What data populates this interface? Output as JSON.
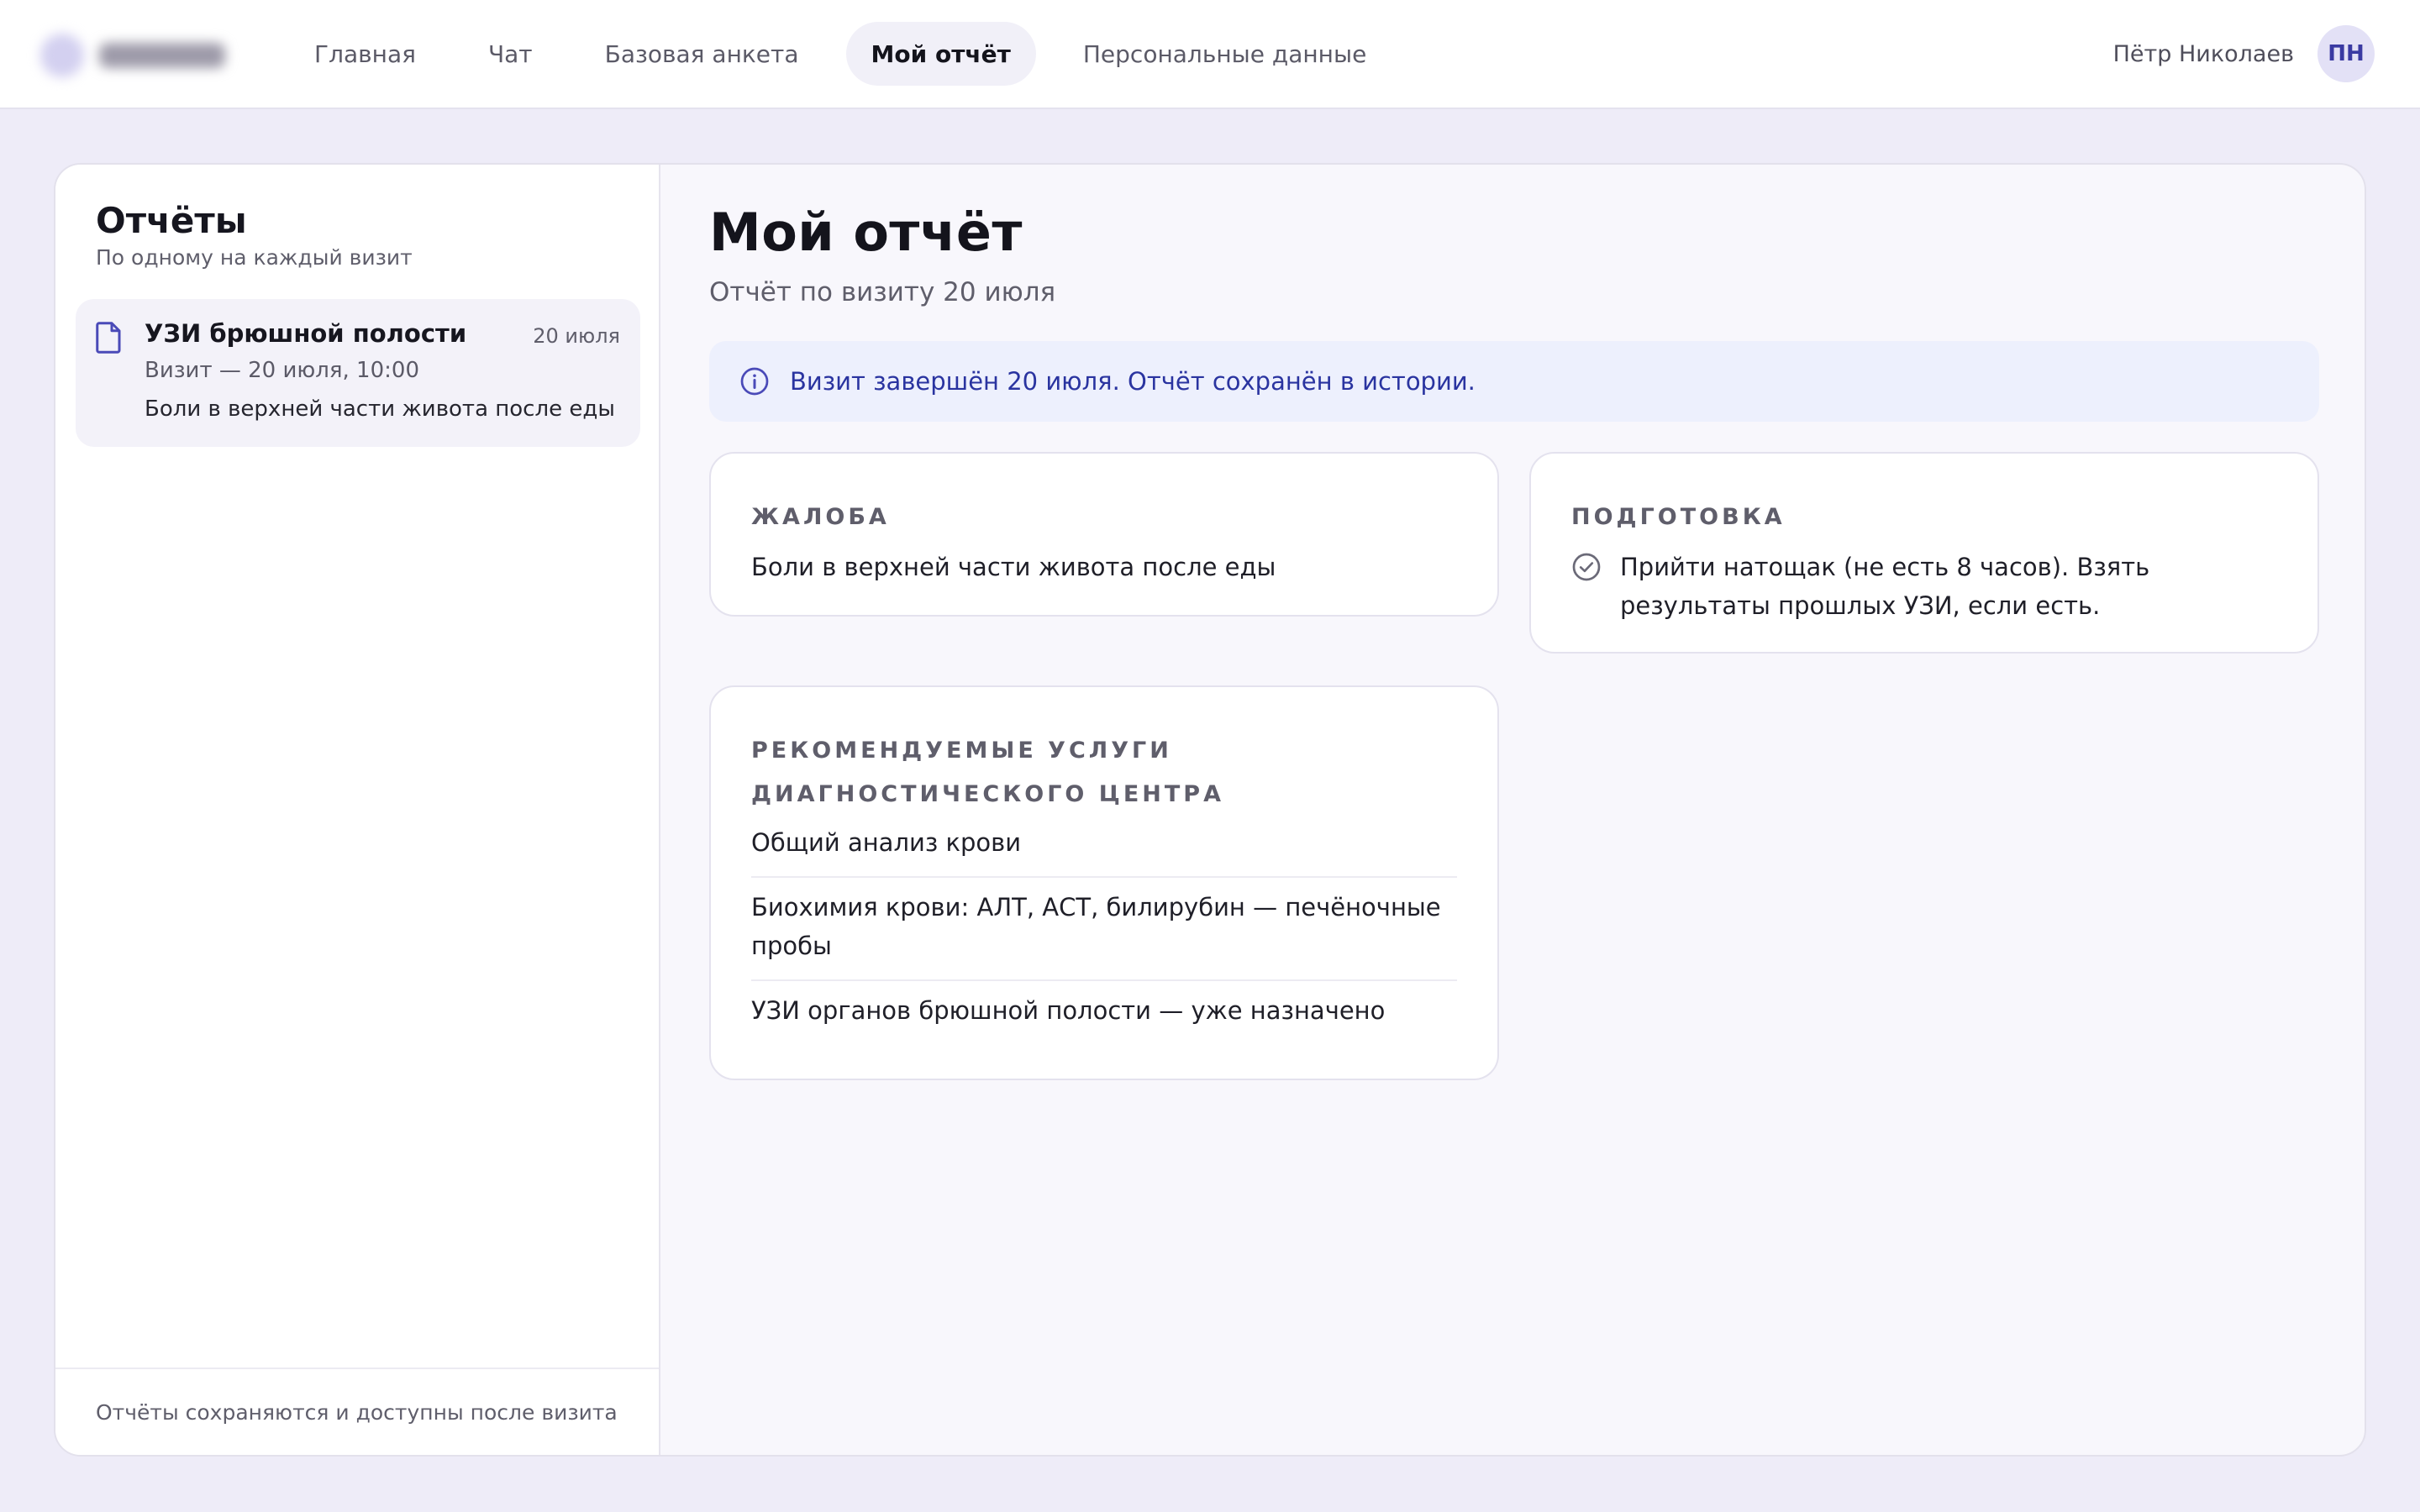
{
  "header": {
    "nav": [
      {
        "label": "Главная",
        "active": false
      },
      {
        "label": "Чат",
        "active": false
      },
      {
        "label": "Базовая анкета",
        "active": false
      },
      {
        "label": "Мой отчёт",
        "active": true
      },
      {
        "label": "Персональные данные",
        "active": false
      }
    ],
    "user_name": "Пётр Николаев",
    "avatar_initials": "ПН"
  },
  "sidebar": {
    "title": "Отчёты",
    "subtitle": "По одному на каждый визит",
    "reports": [
      {
        "icon": "document-icon",
        "title": "УЗИ брюшной полости",
        "date": "20 июля",
        "visit": "Визит — 20 июля, 10:00",
        "description": "Боли в верхней части живота после еды"
      }
    ],
    "footer": "Отчёты сохраняются и доступны после визита"
  },
  "main": {
    "title": "Мой отчёт",
    "subtitle": "Отчёт по визиту 20 июля",
    "info_banner": {
      "icon": "info-icon",
      "text": "Визит завершён 20 июля. Отчёт сохранён в истории."
    },
    "complaint": {
      "label": "Жалоба",
      "text": "Боли в верхней части живота после еды"
    },
    "preparation": {
      "label": "Подготовка",
      "icon": "check-circle-icon",
      "text": "Прийти натощак (не есть 8 часов). Взять результаты прошлых УЗИ, если есть."
    },
    "services": {
      "label": "Рекомендуемые услуги диагностического центра",
      "items": [
        "Общий анализ крови",
        "Биохимия крови: АЛТ, АСТ, билирубин — печёночные пробы",
        "УЗИ органов брюшной полости — уже назначено"
      ]
    }
  },
  "colors": {
    "page_bg": "#eeecf8",
    "accent": "#3a3aa2",
    "info_bg": "#edf0fd",
    "info_text": "#2a34a0"
  }
}
